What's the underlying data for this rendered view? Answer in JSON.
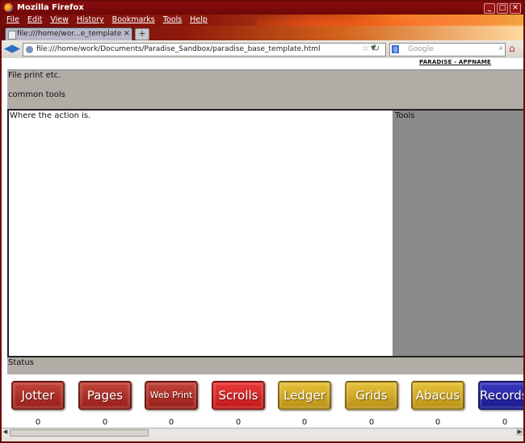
{
  "window": {
    "title": "Mozilla Firefox",
    "controls": [
      "_",
      "□",
      "✕"
    ]
  },
  "menu": [
    "File",
    "Edit",
    "View",
    "History",
    "Bookmarks",
    "Tools",
    "Help"
  ],
  "tab": {
    "title": "file:///home/wor...e_template.html",
    "new_tab_label": "+"
  },
  "nav": {
    "url": "file:///home/work/Documents/Paradise_Sandbox/paradise_base_template.html",
    "search_placeholder": "Google"
  },
  "page": {
    "app_name": "PARADISE - APPNAME",
    "top_line1": "File print etc.",
    "top_line2": "common tools",
    "main_text": "Where the action is.",
    "tools_text": "Tools",
    "status_text": "Status"
  },
  "buttons": [
    {
      "label": "Jotter",
      "count": "0",
      "color": "#a92a22"
    },
    {
      "label": "Pages",
      "count": "0",
      "color": "#a92a22"
    },
    {
      "label": "Web Print",
      "count": "0",
      "color": "#a92a22"
    },
    {
      "label": "Scrolls",
      "count": "0",
      "color": "#d41f1f"
    },
    {
      "label": "Ledger",
      "count": "0",
      "color": "#c9a21e"
    },
    {
      "label": "Grids",
      "count": "0",
      "color": "#c9a21e"
    },
    {
      "label": "Abacus",
      "count": "0",
      "color": "#c9a21e"
    },
    {
      "label": "Records",
      "count": "0",
      "color": "#22229e"
    }
  ]
}
